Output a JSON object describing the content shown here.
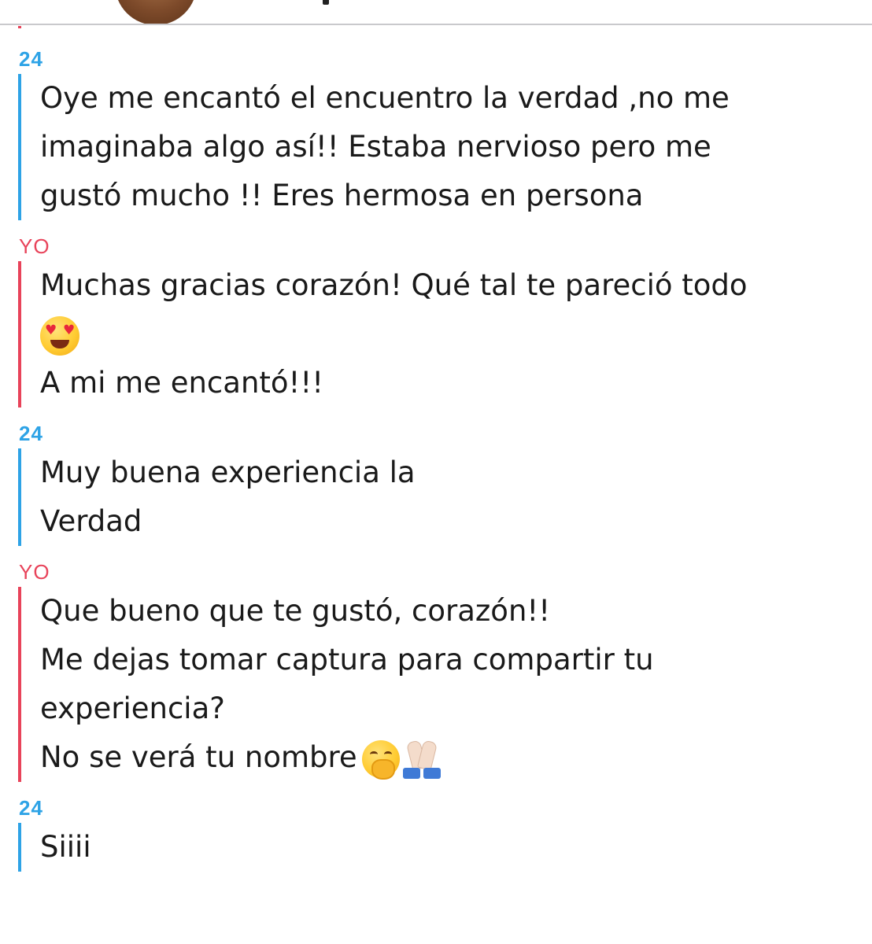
{
  "messages": [
    {
      "sender": "24",
      "from": "them",
      "lines": [
        "Oye me encantó el encuentro la verdad ,no me",
        "imaginaba algo así!! Estaba nervioso pero me",
        "gustó mucho !! Eres hermosa en persona"
      ]
    },
    {
      "sender": "YO",
      "from": "me",
      "lines": [
        "Muchas gracias corazón! Qué tal te pareció todo",
        "",
        "A mi me encantó!!!"
      ],
      "emoji": "smiling-face-with-heart-eyes"
    },
    {
      "sender": "24",
      "from": "them",
      "lines": [
        "Muy buena experiencia la",
        "Verdad"
      ]
    },
    {
      "sender": "YO",
      "from": "me",
      "lines": [
        "Que bueno que te gustó, corazón!!",
        "Me dejas tomar captura para compartir tu",
        "experiencia?",
        "No se verá tu nombre"
      ],
      "emojis": [
        "face-with-hand-over-mouth",
        "folded-hands"
      ]
    },
    {
      "sender": "24",
      "from": "them",
      "lines": [
        "Siiii"
      ]
    }
  ],
  "colors": {
    "them": "#2ea3e6",
    "me": "#e8435a",
    "divider": "#c9c9cc"
  }
}
